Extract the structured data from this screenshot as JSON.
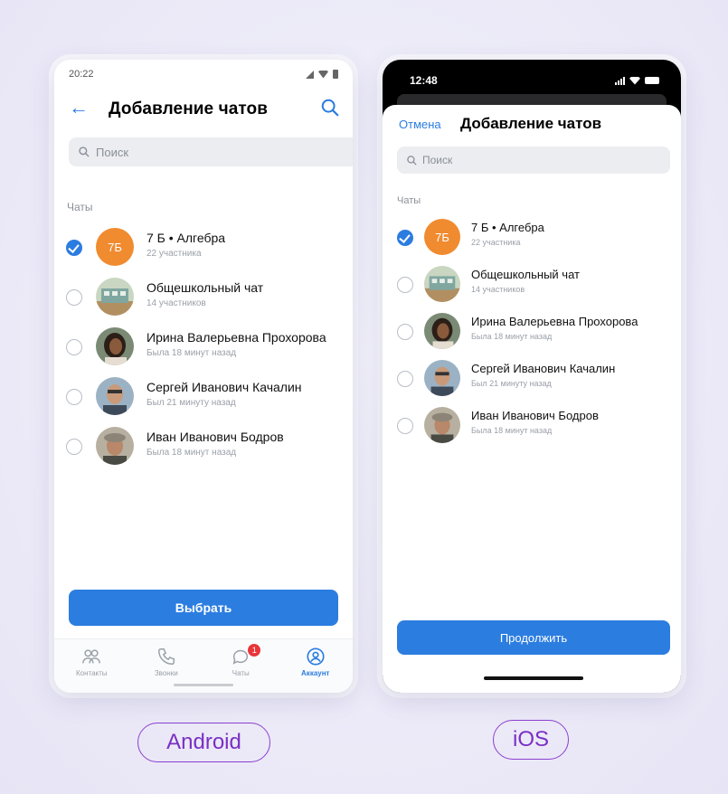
{
  "android": {
    "status_time": "20:22",
    "title": "Добавление чатов",
    "search_placeholder": "Поиск",
    "section_label": "Чаты",
    "chats": [
      {
        "name": "7 Б • Алгебра",
        "sub": "22 участника",
        "avatar_text": "7Б",
        "checked": true
      },
      {
        "name": "Общешкольный чат",
        "sub": "14 участников",
        "checked": false
      },
      {
        "name": "Ирина Валерьевна Прохорова",
        "sub": "Была 18 минут назад",
        "checked": false
      },
      {
        "name": "Сергей Иванович Качалин",
        "sub": "Был 21 минуту назад",
        "checked": false
      },
      {
        "name": "Иван Иванович Бодров",
        "sub": "Была 18 минут назад",
        "checked": false
      }
    ],
    "button_label": "Выбрать",
    "tabs": [
      {
        "label": "Контакты",
        "icon": "contacts-icon"
      },
      {
        "label": "Звонки",
        "icon": "phone-icon"
      },
      {
        "label": "Чаты",
        "icon": "chat-bubble-icon",
        "badge": "1"
      },
      {
        "label": "Аккаунт",
        "icon": "account-icon",
        "active": true
      }
    ]
  },
  "ios": {
    "status_time": "12:48",
    "cancel_label": "Отмена",
    "title": "Добавление чатов",
    "search_placeholder": "Поиск",
    "section_label": "Чаты",
    "chats": [
      {
        "name": "7 Б • Алгебра",
        "sub": "22 участника",
        "avatar_text": "7Б",
        "checked": true
      },
      {
        "name": "Общешкольный чат",
        "sub": "14 участников",
        "checked": false
      },
      {
        "name": "Ирина Валерьевна Прохорова",
        "sub": "Была 18 минут назад",
        "checked": false
      },
      {
        "name": "Сергей Иванович Качалин",
        "sub": "Был 21 минуту назад",
        "checked": false
      },
      {
        "name": "Иван Иванович Бодров",
        "sub": "Была 18 минут назад",
        "checked": false
      }
    ],
    "button_label": "Продолжить"
  },
  "labels": {
    "android": "Android",
    "ios": "iOS"
  },
  "colors": {
    "accent": "#2c7de0",
    "label_purple": "#7a2fc4",
    "avatar_orange": "#f08b30",
    "badge_red": "#e8363a"
  }
}
